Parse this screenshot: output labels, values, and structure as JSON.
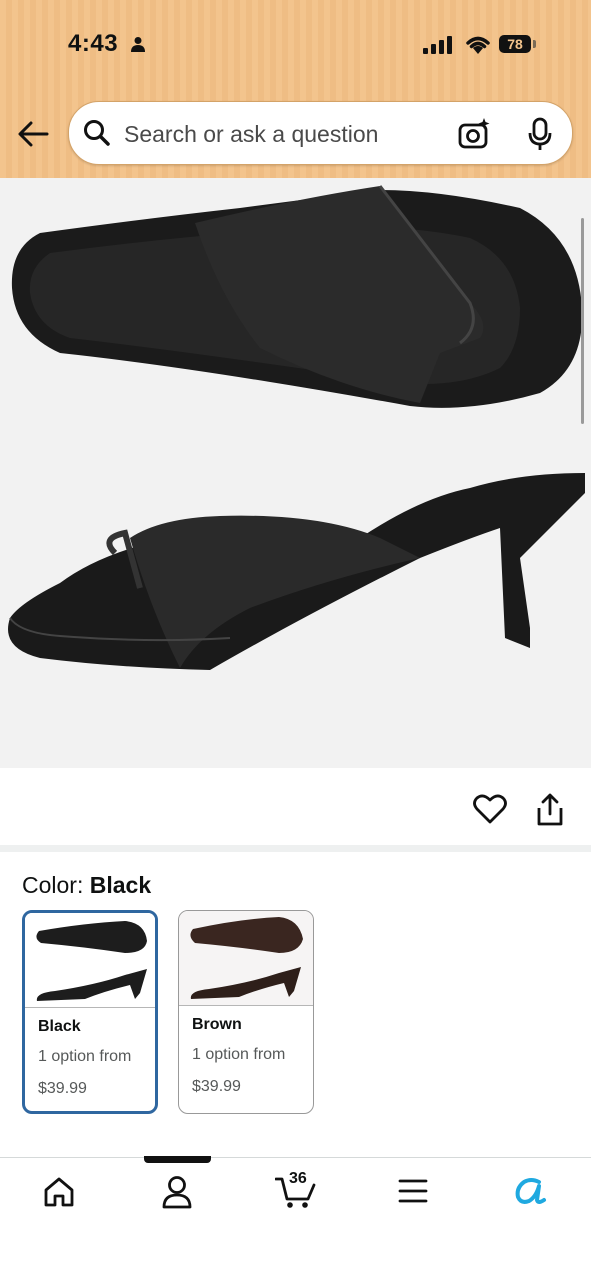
{
  "status_bar": {
    "time": "4:43",
    "battery": "78"
  },
  "search": {
    "placeholder": "Search or ask a question"
  },
  "product": {
    "color_prefix": "Color: ",
    "selected_color": "Black"
  },
  "swatches": [
    {
      "name": "Black",
      "options": "1 option from",
      "price": "$39.99",
      "selected": true
    },
    {
      "name": "Brown",
      "options": "1 option from",
      "price": "$39.99",
      "selected": false
    }
  ],
  "bottom_nav": {
    "items": [
      "home",
      "account",
      "cart",
      "menu",
      "rufus"
    ],
    "cart_count": "36"
  },
  "colors": {
    "header_bg": "#f3c48d",
    "selected_border": "#2f67a0",
    "rufus_accent": "#1fa9e0"
  }
}
